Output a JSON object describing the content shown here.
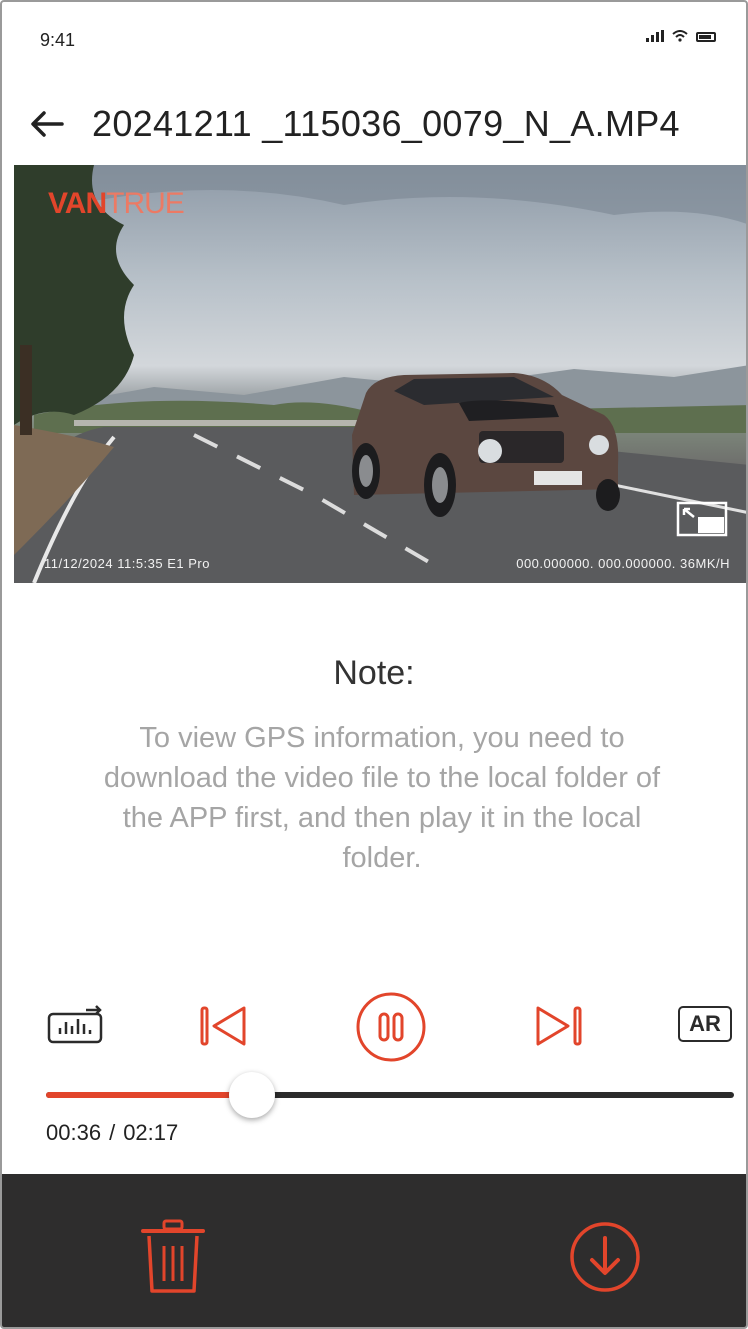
{
  "status_bar": {
    "time": "9:41"
  },
  "header": {
    "title": "20241211 _115036_0079_N_A.MP4",
    "back_icon": "arrow-left-icon"
  },
  "video": {
    "logo_part1": "VAN",
    "logo_part2": "TRUE",
    "overlay_left": "11/12/2024 11:5:35   E1 Pro",
    "overlay_right": "000.000000.   000.000000.   36MK/H"
  },
  "note": {
    "title": "Note:",
    "body": "To view GPS information, you need to download the video file to the local folder of the APP first, and then play it in the local folder."
  },
  "controls": {
    "ar_label": "AR",
    "state": "playing",
    "progress_fraction": 0.3,
    "current_time": "00:36",
    "separator": "/",
    "total_time": "02:17"
  },
  "colors": {
    "accent": "#e2452b",
    "bottom_bar": "#2e2d2d",
    "note_text": "#a5a5a5"
  },
  "bottom_bar": {
    "delete_icon": "trash-icon",
    "download_icon": "download-icon"
  }
}
